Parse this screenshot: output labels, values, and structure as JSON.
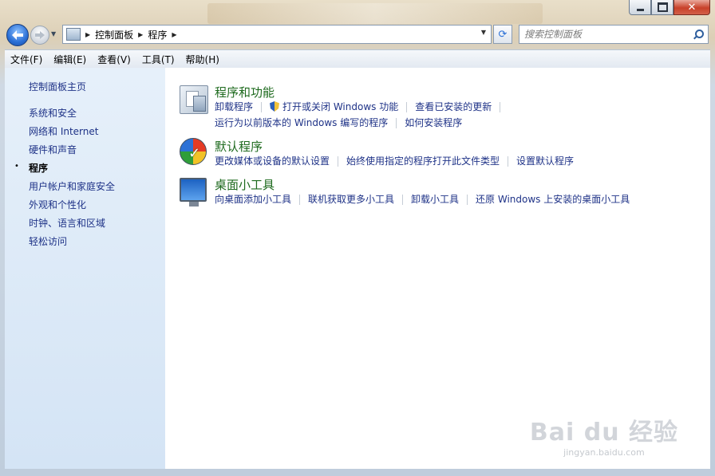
{
  "window": {
    "min_glyph": "min",
    "max_glyph": "max",
    "close_glyph": "✕"
  },
  "nav": {
    "breadcrumb": [
      "控制面板",
      "程序"
    ],
    "search_placeholder": "搜索控制面板"
  },
  "menu": [
    "文件(F)",
    "编辑(E)",
    "查看(V)",
    "工具(T)",
    "帮助(H)"
  ],
  "sidebar": {
    "items": [
      "控制面板主页",
      "系统和安全",
      "网络和 Internet",
      "硬件和声音",
      "程序",
      "用户帐户和家庭安全",
      "外观和个性化",
      "时钟、语言和区域",
      "轻松访问"
    ],
    "current": "程序",
    "bullet": "•"
  },
  "categories": [
    {
      "title": "程序和功能",
      "icon": "programs-icon",
      "links_row1": [
        "卸载程序",
        "打开或关闭 Windows 功能",
        "查看已安装的更新"
      ],
      "links_row2": [
        "运行为以前版本的 Windows 编写的程序",
        "如何安装程序"
      ]
    },
    {
      "title": "默认程序",
      "icon": "default-programs-icon",
      "links_row1": [
        "更改媒体或设备的默认设置",
        "始终使用指定的程序打开此文件类型",
        "设置默认程序"
      ]
    },
    {
      "title": "桌面小工具",
      "icon": "desktop-gadgets-icon",
      "links_row1": [
        "向桌面添加小工具",
        "联机获取更多小工具",
        "卸载小工具",
        "还原 Windows 上安装的桌面小工具"
      ]
    }
  ],
  "watermark": {
    "brand": "Bai du 经验",
    "url": "jingyan.baidu.com"
  },
  "colors": {
    "link": "#1e3287",
    "category_title": "#1e6a1e",
    "sidebar_bg": "#dbe8f6"
  }
}
